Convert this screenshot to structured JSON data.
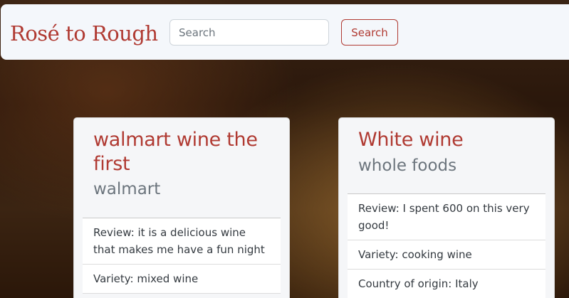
{
  "navbar": {
    "brand": "Rosé to Rough",
    "search_placeholder": "Search",
    "search_button": "Search"
  },
  "cards": [
    {
      "title": "walmart wine the first",
      "store": "walmart",
      "details": [
        "Review: it is a delicious wine that makes me have a fun night",
        "Variety: mixed wine"
      ]
    },
    {
      "title": "White wine",
      "store": "whole foods",
      "details": [
        "Review: I spent 600 on this very good!",
        "Variety: cooking wine",
        "Country of origin: Italy"
      ]
    }
  ]
}
